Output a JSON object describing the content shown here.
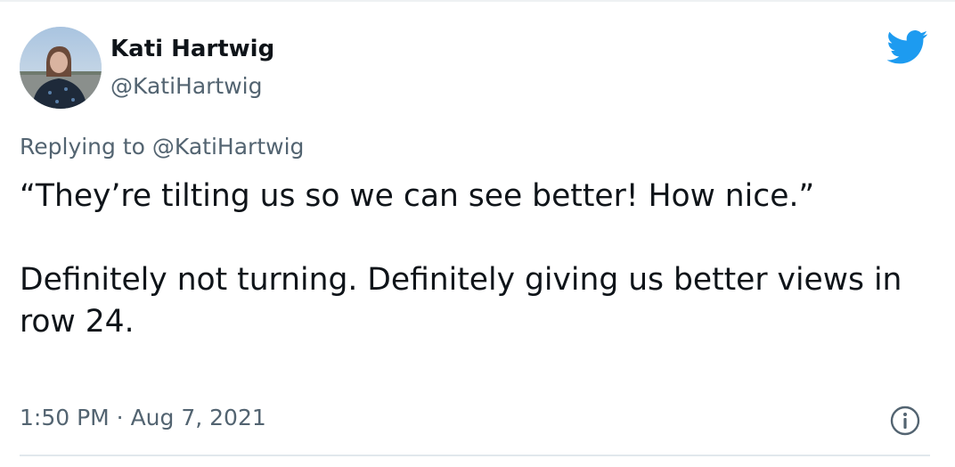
{
  "author": {
    "display_name": "Kati Hartwig",
    "handle": "@KatiHartwig"
  },
  "reply": {
    "prefix": "Replying to",
    "handle": "@KatiHartwig"
  },
  "tweet": {
    "text": "“They’re tilting us so we can see better! How nice.”\n\nDefinitely not turning. Definitely giving us better views in row 24."
  },
  "meta": {
    "timestamp": "1:50 PM · Aug 7, 2021"
  },
  "colors": {
    "twitter_blue": "#1d9bf0",
    "secondary_text": "#536471",
    "primary_text": "#0f1419"
  },
  "icons": {
    "brand": "twitter-bird-icon",
    "info": "info-icon"
  }
}
